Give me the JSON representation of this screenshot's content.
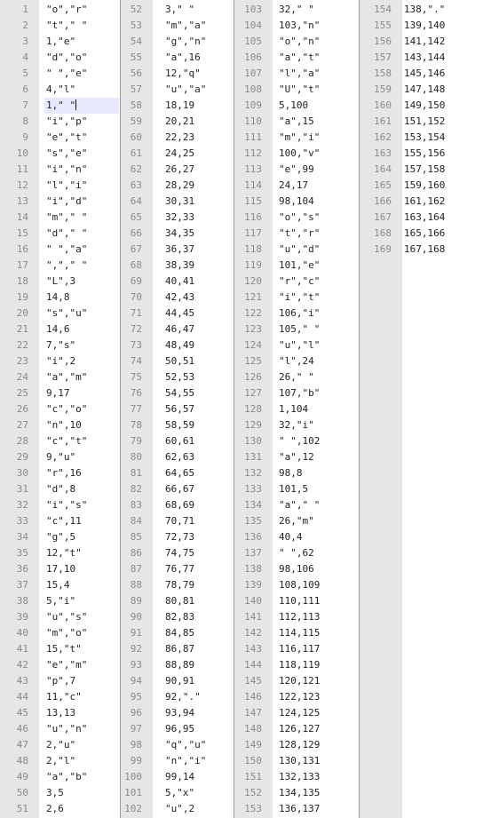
{
  "editor": {
    "active_line": 7,
    "panes": [
      {
        "lines": [
          {
            "n": "1",
            "t": "\"o\",\"r\""
          },
          {
            "n": "2",
            "t": "\"t\",\" \""
          },
          {
            "n": "3",
            "t": "1,\"e\""
          },
          {
            "n": "4",
            "t": "\"d\",\"o\""
          },
          {
            "n": "5",
            "t": "\" \",\"e\""
          },
          {
            "n": "6",
            "t": "4,\"l\""
          },
          {
            "n": "7",
            "t": "1,\" \""
          },
          {
            "n": "8",
            "t": "\"i\",\"p\""
          },
          {
            "n": "9",
            "t": "\"e\",\"t\""
          },
          {
            "n": "10",
            "t": "\"s\",\"e\""
          },
          {
            "n": "11",
            "t": "\"i\",\"n\""
          },
          {
            "n": "12",
            "t": "\"l\",\"i\""
          },
          {
            "n": "13",
            "t": "\"i\",\"d\""
          },
          {
            "n": "14",
            "t": "\"m\",\" \""
          },
          {
            "n": "15",
            "t": "\"d\",\" \""
          },
          {
            "n": "16",
            "t": "\" \",\"a\""
          },
          {
            "n": "17",
            "t": "\",\",\" \""
          },
          {
            "n": "18",
            "t": "\"L\",3"
          },
          {
            "n": "19",
            "t": "14,8"
          },
          {
            "n": "20",
            "t": "\"s\",\"u\""
          },
          {
            "n": "21",
            "t": "14,6"
          },
          {
            "n": "22",
            "t": "7,\"s\""
          },
          {
            "n": "23",
            "t": "\"i\",2"
          },
          {
            "n": "24",
            "t": "\"a\",\"m\""
          },
          {
            "n": "25",
            "t": "9,17"
          },
          {
            "n": "26",
            "t": "\"c\",\"o\""
          },
          {
            "n": "27",
            "t": "\"n\",10"
          },
          {
            "n": "28",
            "t": "\"c\",\"t\""
          },
          {
            "n": "29",
            "t": "9,\"u\""
          },
          {
            "n": "30",
            "t": "\"r\",16"
          },
          {
            "n": "31",
            "t": "\"d\",8"
          },
          {
            "n": "32",
            "t": "\"i\",\"s\""
          },
          {
            "n": "33",
            "t": "\"c\",11"
          },
          {
            "n": "34",
            "t": "\"g\",5"
          },
          {
            "n": "35",
            "t": "12,\"t\""
          },
          {
            "n": "36",
            "t": "17,10"
          },
          {
            "n": "37",
            "t": "15,4"
          },
          {
            "n": "38",
            "t": "5,\"i\""
          },
          {
            "n": "39",
            "t": "\"u\",\"s\""
          },
          {
            "n": "40",
            "t": "\"m\",\"o\""
          },
          {
            "n": "41",
            "t": "15,\"t\""
          },
          {
            "n": "42",
            "t": "\"e\",\"m\""
          },
          {
            "n": "43",
            "t": "\"p\",7"
          },
          {
            "n": "44",
            "t": "11,\"c\""
          },
          {
            "n": "45",
            "t": "13,13"
          },
          {
            "n": "46",
            "t": "\"u\",\"n\""
          },
          {
            "n": "47",
            "t": "2,\"u\""
          },
          {
            "n": "48",
            "t": "2,\"l\""
          },
          {
            "n": "49",
            "t": "\"a\",\"b\""
          },
          {
            "n": "50",
            "t": "3,5"
          },
          {
            "n": "51",
            "t": "2,6"
          }
        ]
      },
      {
        "lines": [
          {
            "n": "52",
            "t": "3,\" \""
          },
          {
            "n": "53",
            "t": "\"m\",\"a\""
          },
          {
            "n": "54",
            "t": "\"g\",\"n\""
          },
          {
            "n": "55",
            "t": "\"a\",16"
          },
          {
            "n": "56",
            "t": "12,\"q\""
          },
          {
            "n": "57",
            "t": "\"u\",\"a\""
          },
          {
            "n": "58",
            "t": "18,19"
          },
          {
            "n": "59",
            "t": "20,21"
          },
          {
            "n": "60",
            "t": "22,23"
          },
          {
            "n": "61",
            "t": "24,25"
          },
          {
            "n": "62",
            "t": "26,27"
          },
          {
            "n": "63",
            "t": "28,29"
          },
          {
            "n": "64",
            "t": "30,31"
          },
          {
            "n": "65",
            "t": "32,33"
          },
          {
            "n": "66",
            "t": "34,35"
          },
          {
            "n": "67",
            "t": "36,37"
          },
          {
            "n": "68",
            "t": "38,39"
          },
          {
            "n": "69",
            "t": "40,41"
          },
          {
            "n": "70",
            "t": "42,43"
          },
          {
            "n": "71",
            "t": "44,45"
          },
          {
            "n": "72",
            "t": "46,47"
          },
          {
            "n": "73",
            "t": "48,49"
          },
          {
            "n": "74",
            "t": "50,51"
          },
          {
            "n": "75",
            "t": "52,53"
          },
          {
            "n": "76",
            "t": "54,55"
          },
          {
            "n": "77",
            "t": "56,57"
          },
          {
            "n": "78",
            "t": "58,59"
          },
          {
            "n": "79",
            "t": "60,61"
          },
          {
            "n": "80",
            "t": "62,63"
          },
          {
            "n": "81",
            "t": "64,65"
          },
          {
            "n": "82",
            "t": "66,67"
          },
          {
            "n": "83",
            "t": "68,69"
          },
          {
            "n": "84",
            "t": "70,71"
          },
          {
            "n": "85",
            "t": "72,73"
          },
          {
            "n": "86",
            "t": "74,75"
          },
          {
            "n": "87",
            "t": "76,77"
          },
          {
            "n": "88",
            "t": "78,79"
          },
          {
            "n": "89",
            "t": "80,81"
          },
          {
            "n": "90",
            "t": "82,83"
          },
          {
            "n": "91",
            "t": "84,85"
          },
          {
            "n": "92",
            "t": "86,87"
          },
          {
            "n": "93",
            "t": "88,89"
          },
          {
            "n": "94",
            "t": "90,91"
          },
          {
            "n": "95",
            "t": "92,\".\""
          },
          {
            "n": "96",
            "t": "93,94"
          },
          {
            "n": "97",
            "t": "96,95"
          },
          {
            "n": "98",
            "t": "\"q\",\"u\""
          },
          {
            "n": "99",
            "t": "\"n\",\"i\""
          },
          {
            "n": "100",
            "t": "99,14"
          },
          {
            "n": "101",
            "t": "5,\"x\""
          },
          {
            "n": "102",
            "t": "\"u\",2"
          }
        ]
      },
      {
        "lines": [
          {
            "n": "103",
            "t": "32,\" \""
          },
          {
            "n": "104",
            "t": "103,\"n\""
          },
          {
            "n": "105",
            "t": "\"o\",\"n\""
          },
          {
            "n": "106",
            "t": "\"a\",\"t\""
          },
          {
            "n": "107",
            "t": "\"l\",\"a\""
          },
          {
            "n": "108",
            "t": "\"U\",\"t\""
          },
          {
            "n": "109",
            "t": "5,100"
          },
          {
            "n": "110",
            "t": "\"a\",15"
          },
          {
            "n": "111",
            "t": "\"m\",\"i\""
          },
          {
            "n": "112",
            "t": "100,\"v\""
          },
          {
            "n": "113",
            "t": "\"e\",99"
          },
          {
            "n": "114",
            "t": "24,17"
          },
          {
            "n": "115",
            "t": "98,104"
          },
          {
            "n": "116",
            "t": "\"o\",\"s\""
          },
          {
            "n": "117",
            "t": "\"t\",\"r\""
          },
          {
            "n": "118",
            "t": "\"u\",\"d\""
          },
          {
            "n": "119",
            "t": "101,\"e\""
          },
          {
            "n": "120",
            "t": "\"r\",\"c\""
          },
          {
            "n": "121",
            "t": "\"i\",\"t\""
          },
          {
            "n": "122",
            "t": "106,\"i\""
          },
          {
            "n": "123",
            "t": "105,\" \""
          },
          {
            "n": "124",
            "t": "\"u\",\"l\""
          },
          {
            "n": "125",
            "t": "\"l\",24"
          },
          {
            "n": "126",
            "t": "26,\" \""
          },
          {
            "n": "127",
            "t": "107,\"b\""
          },
          {
            "n": "128",
            "t": "1,104"
          },
          {
            "n": "129",
            "t": "32,\"i\""
          },
          {
            "n": "130",
            "t": "\" \",102"
          },
          {
            "n": "131",
            "t": "\"a\",12"
          },
          {
            "n": "132",
            "t": "98,8"
          },
          {
            "n": "133",
            "t": "101,5"
          },
          {
            "n": "134",
            "t": "\"a\",\" \""
          },
          {
            "n": "135",
            "t": "26,\"m\""
          },
          {
            "n": "136",
            "t": "40,4"
          },
          {
            "n": "137",
            "t": "\" \",62"
          },
          {
            "n": "138",
            "t": "98,106"
          },
          {
            "n": "139",
            "t": "108,109"
          },
          {
            "n": "140",
            "t": "110,111"
          },
          {
            "n": "141",
            "t": "112,113"
          },
          {
            "n": "142",
            "t": "114,115"
          },
          {
            "n": "143",
            "t": "116,117"
          },
          {
            "n": "144",
            "t": "118,119"
          },
          {
            "n": "145",
            "t": "120,121"
          },
          {
            "n": "146",
            "t": "122,123"
          },
          {
            "n": "147",
            "t": "124,125"
          },
          {
            "n": "148",
            "t": "126,127"
          },
          {
            "n": "149",
            "t": "128,129"
          },
          {
            "n": "150",
            "t": "130,131"
          },
          {
            "n": "151",
            "t": "132,133"
          },
          {
            "n": "152",
            "t": "134,135"
          },
          {
            "n": "153",
            "t": "136,137"
          }
        ]
      },
      {
        "lines": [
          {
            "n": "154",
            "t": "138,\".\""
          },
          {
            "n": "155",
            "t": "139,140"
          },
          {
            "n": "156",
            "t": "141,142"
          },
          {
            "n": "157",
            "t": "143,144"
          },
          {
            "n": "158",
            "t": "145,146"
          },
          {
            "n": "159",
            "t": "147,148"
          },
          {
            "n": "160",
            "t": "149,150"
          },
          {
            "n": "161",
            "t": "151,152"
          },
          {
            "n": "162",
            "t": "153,154"
          },
          {
            "n": "163",
            "t": "155,156"
          },
          {
            "n": "164",
            "t": "157,158"
          },
          {
            "n": "165",
            "t": "159,160"
          },
          {
            "n": "166",
            "t": "161,162"
          },
          {
            "n": "167",
            "t": "163,164"
          },
          {
            "n": "168",
            "t": "165,166"
          },
          {
            "n": "169",
            "t": "167,168"
          }
        ]
      }
    ]
  }
}
